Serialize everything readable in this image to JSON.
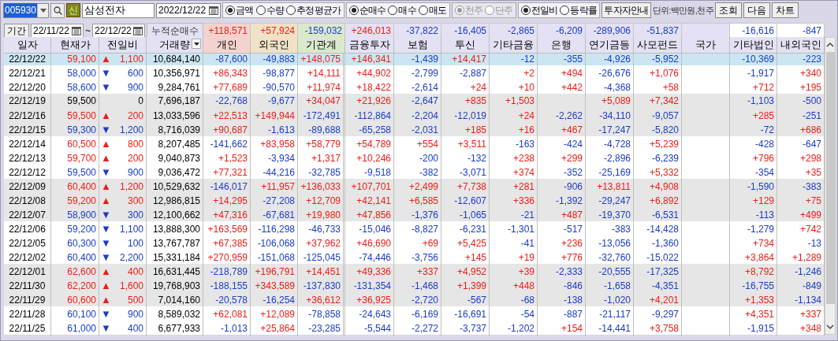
{
  "toolbar": {
    "stock_code": {
      "value": "005930",
      "selected": true
    },
    "new_badge": "신",
    "stock_name": "삼성전자",
    "date": "2022/12/22",
    "radio_groups": [
      {
        "disabled": false,
        "options": [
          {
            "label": "금액",
            "selected": true
          },
          {
            "label": "수량",
            "selected": false
          },
          {
            "label": "추정평균가",
            "selected": false
          }
        ]
      },
      {
        "disabled": false,
        "options": [
          {
            "label": "순매수",
            "selected": true
          },
          {
            "label": "매수",
            "selected": false
          },
          {
            "label": "매도",
            "selected": false
          }
        ]
      },
      {
        "disabled": true,
        "options": [
          {
            "label": "천주",
            "selected": true
          },
          {
            "label": "단주",
            "selected": false
          }
        ]
      },
      {
        "disabled": false,
        "options": [
          {
            "label": "전일비",
            "selected": true
          },
          {
            "label": "등락률",
            "selected": false
          }
        ]
      }
    ],
    "guide_button": "투자자안내",
    "unit_label": "단위:백만원,천주",
    "buttons": [
      "조회",
      "다음",
      "차트"
    ]
  },
  "period": {
    "label": "기간",
    "start": "22/11/22",
    "separator": "~",
    "end": "22/12/22",
    "cumulative_label": "누적순매수",
    "totals": [
      "+118,571",
      "+57,924",
      "-159,032",
      "+246,013",
      "-37,822",
      "-16,405",
      "-2,865",
      "-6,209",
      "-289,906",
      "-51,837"
    ],
    "other_totals": [
      "-16,616",
      "-847"
    ]
  },
  "table": {
    "columns": [
      {
        "label": "일자"
      },
      {
        "label": "현재가"
      },
      {
        "label": "전일비"
      },
      {
        "label": "거래량",
        "has_dropdown": true
      },
      {
        "label": "개인"
      },
      {
        "label": "외국인"
      },
      {
        "label": "기관계"
      },
      {
        "label": "금융투자"
      },
      {
        "label": "보험"
      },
      {
        "label": "투신"
      },
      {
        "label": "기타금융"
      },
      {
        "label": "은행"
      },
      {
        "label": "연기금등"
      },
      {
        "label": "사모펀드"
      },
      {
        "label": "국가"
      },
      {
        "label": "기타법인"
      },
      {
        "label": "내외국인"
      }
    ],
    "rows": [
      {
        "selected": true,
        "color": "#ee1d16",
        "arrow": "▲",
        "cells": [
          "22/12/22",
          "59,100",
          "1,100",
          "10,684,140",
          "-87,600",
          "-49,883",
          "+148,075",
          "+146,341",
          "-1,439",
          "+14,417",
          "-12",
          "-355",
          "-4,926",
          "-5,952",
          "",
          "-10,369",
          "-223"
        ]
      },
      {
        "selected": false,
        "color": "#1a3cc8",
        "arrow": "▼",
        "cells": [
          "22/12/21",
          "58,000",
          "600",
          "10,356,971",
          "+86,343",
          "-98,877",
          "+14,111",
          "+44,902",
          "-2,799",
          "-2,887",
          "+2",
          "+494",
          "-26,676",
          "+1,076",
          "",
          "-1,917",
          "+340"
        ]
      },
      {
        "selected": false,
        "color": "#1a3cc8",
        "arrow": "▼",
        "cells": [
          "22/12/20",
          "58,600",
          "900",
          "9,284,761",
          "+77,689",
          "-90,570",
          "+11,974",
          "+18,422",
          "-2,614",
          "+24",
          "+10",
          "+442",
          "-4,368",
          "+58",
          "",
          "+712",
          "+195"
        ]
      },
      {
        "selected": false,
        "color": "#000000",
        "cells": [
          "22/12/19",
          "59,500",
          "0",
          "7,696,187",
          "-22,768",
          "-9,677",
          "+34,047",
          "+21,926",
          "-2,647",
          "+835",
          "+1,503",
          "",
          "+5,089",
          "+7,342",
          "",
          "-1,103",
          "-500"
        ]
      },
      {
        "selected": false,
        "color": "#ee1d16",
        "arrow": "▲",
        "cells": [
          "22/12/16",
          "59,500",
          "200",
          "13,033,596",
          "+22,513",
          "+149,944",
          "-172,491",
          "-112,864",
          "-2,204",
          "-12,019",
          "+24",
          "-2,262",
          "-34,110",
          "-9,057",
          "",
          "+285",
          "-251"
        ]
      },
      {
        "selected": false,
        "color": "#1a3cc8",
        "arrow": "▼",
        "cells": [
          "22/12/15",
          "59,300",
          "1,200",
          "8,716,039",
          "+90,687",
          "-1,613",
          "-89,688",
          "-65,258",
          "-2,031",
          "+185",
          "+16",
          "+467",
          "-17,247",
          "-5,820",
          "",
          "-72",
          "+686"
        ]
      },
      {
        "selected": false,
        "color": "#ee1d16",
        "arrow": "▲",
        "cells": [
          "22/12/14",
          "60,500",
          "800",
          "8,207,485",
          "-141,662",
          "+83,958",
          "+58,779",
          "+54,789",
          "+554",
          "+3,511",
          "-163",
          "-424",
          "-4,728",
          "+5,239",
          "",
          "-428",
          "-647"
        ]
      },
      {
        "selected": false,
        "color": "#ee1d16",
        "arrow": "▲",
        "cells": [
          "22/12/13",
          "59,700",
          "200",
          "9,040,873",
          "+1,523",
          "-3,934",
          "+1,317",
          "+10,246",
          "-200",
          "-132",
          "+238",
          "+299",
          "-2,896",
          "-6,239",
          "",
          "+796",
          "+298"
        ]
      },
      {
        "selected": false,
        "color": "#1a3cc8",
        "arrow": "▼",
        "cells": [
          "22/12/12",
          "59,500",
          "900",
          "9,036,472",
          "+77,321",
          "-44,216",
          "-32,785",
          "-9,518",
          "-382",
          "-3,071",
          "+374",
          "-352",
          "-25,169",
          "+5,332",
          "",
          "-354",
          "+35"
        ]
      },
      {
        "selected": false,
        "color": "#ee1d16",
        "arrow": "▲",
        "cells": [
          "22/12/09",
          "60,400",
          "1,200",
          "10,529,632",
          "-146,017",
          "+11,957",
          "+136,033",
          "+107,701",
          "+2,499",
          "+7,738",
          "+281",
          "-906",
          "+13,811",
          "+4,908",
          "",
          "-1,590",
          "-383"
        ]
      },
      {
        "selected": false,
        "color": "#ee1d16",
        "arrow": "▲",
        "cells": [
          "22/12/08",
          "59,200",
          "300",
          "12,986,815",
          "+14,295",
          "-27,208",
          "+12,709",
          "+42,141",
          "+6,585",
          "-12,607",
          "+336",
          "-1,392",
          "-29,247",
          "+6,892",
          "",
          "+129",
          "+75"
        ]
      },
      {
        "selected": false,
        "color": "#1a3cc8",
        "arrow": "▼",
        "cells": [
          "22/12/07",
          "58,900",
          "300",
          "12,100,662",
          "+47,316",
          "-67,681",
          "+19,980",
          "+47,856",
          "-1,376",
          "-1,065",
          "-21",
          "+487",
          "-19,370",
          "-6,531",
          "",
          "-113",
          "+499"
        ]
      },
      {
        "selected": false,
        "color": "#1a3cc8",
        "arrow": "▼",
        "cells": [
          "22/12/06",
          "59,200",
          "1,100",
          "13,888,300",
          "+163,569",
          "-116,298",
          "-46,733",
          "-15,046",
          "-8,827",
          "-6,231",
          "-1,301",
          "-517",
          "-383",
          "-14,428",
          "",
          "-1,279",
          "+742"
        ]
      },
      {
        "selected": false,
        "color": "#1a3cc8",
        "arrow": "▼",
        "cells": [
          "22/12/05",
          "60,300",
          "100",
          "13,767,787",
          "+67,385",
          "-106,068",
          "+37,962",
          "+46,690",
          "+69",
          "+5,425",
          "-41",
          "+236",
          "-13,056",
          "-1,360",
          "",
          "+734",
          "-13"
        ]
      },
      {
        "selected": false,
        "color": "#1a3cc8",
        "arrow": "▼",
        "cells": [
          "22/12/02",
          "60,400",
          "2,200",
          "15,331,184",
          "+270,959",
          "-151,068",
          "-125,045",
          "-74,446",
          "-3,756",
          "+145",
          "+19",
          "+776",
          "-32,760",
          "-15,022",
          "",
          "+3,864",
          "+1,289"
        ]
      },
      {
        "selected": false,
        "color": "#ee1d16",
        "arrow": "▲",
        "cells": [
          "22/12/01",
          "62,600",
          "400",
          "16,631,445",
          "-218,789",
          "+196,791",
          "+14,451",
          "+49,336",
          "+337",
          "+4,952",
          "+39",
          "-2,333",
          "-20,555",
          "-17,325",
          "",
          "+8,792",
          "-1,246"
        ]
      },
      {
        "selected": false,
        "color": "#ee1d16",
        "arrow": "▲",
        "cells": [
          "22/11/30",
          "62,200",
          "1,600",
          "19,768,903",
          "-188,155",
          "+343,589",
          "-137,830",
          "-131,354",
          "-1,468",
          "+1,399",
          "+448",
          "-846",
          "-1,658",
          "-4,351",
          "",
          "-16,755",
          "-849"
        ]
      },
      {
        "selected": false,
        "color": "#ee1d16",
        "arrow": "▲",
        "cells": [
          "22/11/29",
          "60,600",
          "500",
          "7,014,160",
          "-20,578",
          "-16,254",
          "+36,612",
          "+36,925",
          "-2,720",
          "-567",
          "-68",
          "-138",
          "-1,020",
          "+4,201",
          "",
          "+1,353",
          "-1,134"
        ]
      },
      {
        "selected": false,
        "color": "#1a3cc8",
        "arrow": "▼",
        "cells": [
          "22/11/28",
          "60,100",
          "900",
          "8,589,032",
          "+62,081",
          "+12,089",
          "-78,858",
          "-24,643",
          "-6,169",
          "-16,691",
          "-54",
          "-887",
          "-21,117",
          "-9,297",
          "",
          "+4,351",
          "+337"
        ]
      },
      {
        "selected": false,
        "color": "#1a3cc8",
        "arrow": "▼",
        "cells": [
          "22/11/25",
          "61,000",
          "400",
          "6,677,933",
          "-1,013",
          "+25,864",
          "-23,285",
          "-5,544",
          "-2,272",
          "-3,737",
          "-1,202",
          "+154",
          "-14,441",
          "+3,758",
          "",
          "-1,915",
          "+348"
        ]
      }
    ]
  }
}
